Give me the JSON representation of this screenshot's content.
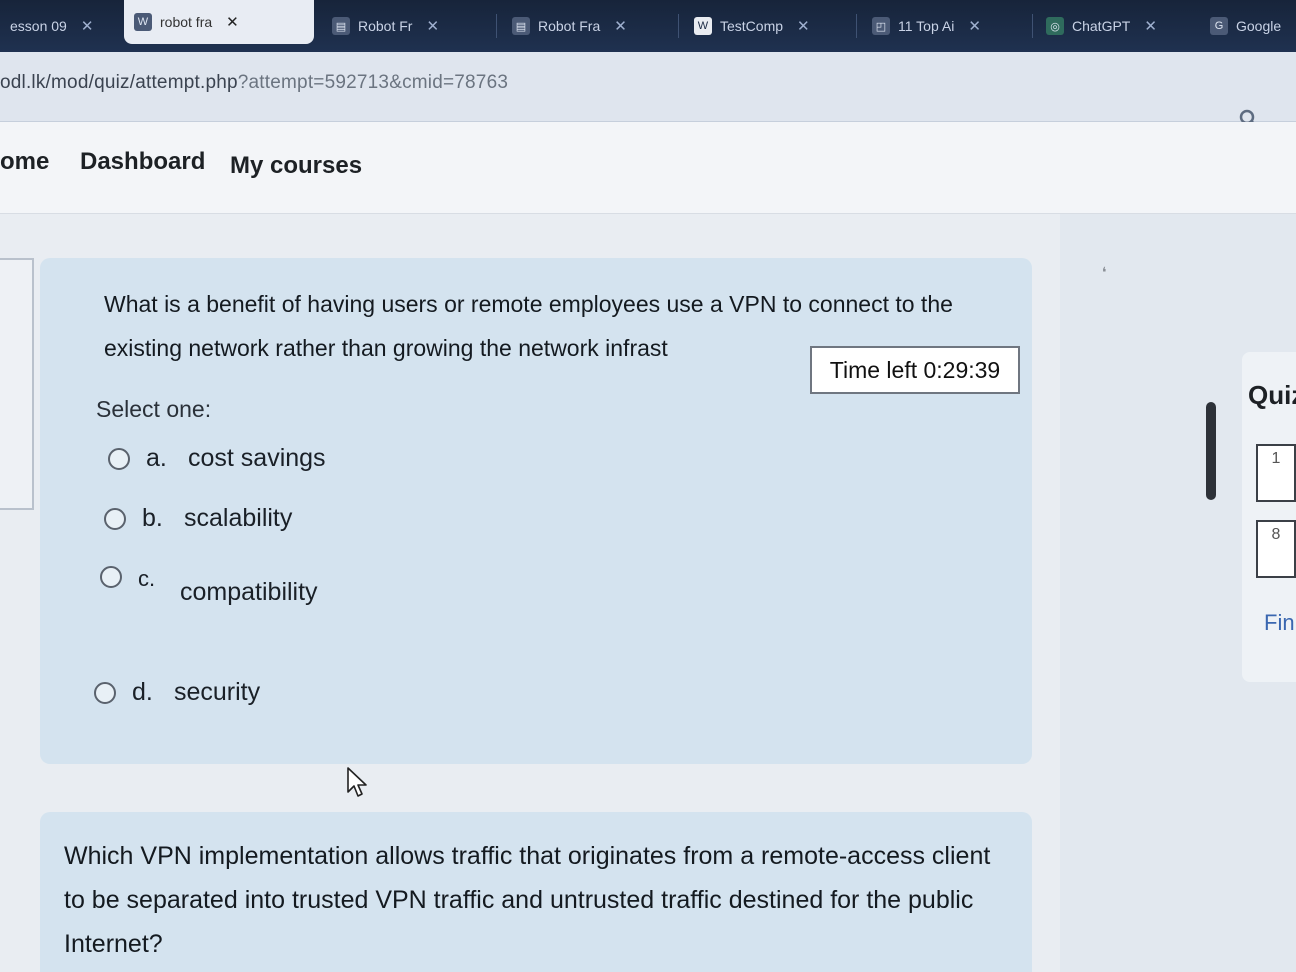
{
  "browser": {
    "tabs": [
      {
        "favicon": "",
        "label": "esson 09",
        "active": false
      },
      {
        "favicon": "W",
        "label": "robot fra",
        "active": true
      },
      {
        "favicon": "doc",
        "label": "Robot Fr",
        "active": false
      },
      {
        "favicon": "doc",
        "label": "Robot Fra",
        "active": false
      },
      {
        "favicon": "W",
        "label": "TestComp",
        "active": false
      },
      {
        "favicon": "doc",
        "label": "11 Top Ai",
        "active": false
      },
      {
        "favicon": "ai",
        "label": "ChatGPT",
        "active": false
      },
      {
        "favicon": "G",
        "label": "Google",
        "active": false
      }
    ],
    "close_glyph": "✕",
    "url_host": "odl.lk/mod/quiz/attempt.php",
    "url_query": "?attempt=592713&cmid=78763"
  },
  "nav": {
    "home": "ome",
    "dashboard": "Dashboard",
    "my_courses": "My courses"
  },
  "question1": {
    "text": "What is a benefit of having users or remote employees use a VPN to connect to the existing network rather than growing the network infrast",
    "select_label": "Select one:",
    "options": [
      {
        "letter": "a.",
        "text": "cost savings"
      },
      {
        "letter": "b.",
        "text": "scalability"
      },
      {
        "letter": "c.",
        "text": "compatibility"
      },
      {
        "letter": "d.",
        "text": "security"
      }
    ]
  },
  "timer": {
    "text": "Time left 0:29:39"
  },
  "question2": {
    "text": "Which VPN implementation allows traffic that originates from a remote-access client to be separated into trusted VPN traffic and untrusted traffic destined for the public Internet?"
  },
  "quiz_nav": {
    "title": "Quiz",
    "items": [
      "1",
      "8"
    ],
    "finish": "Fin"
  }
}
